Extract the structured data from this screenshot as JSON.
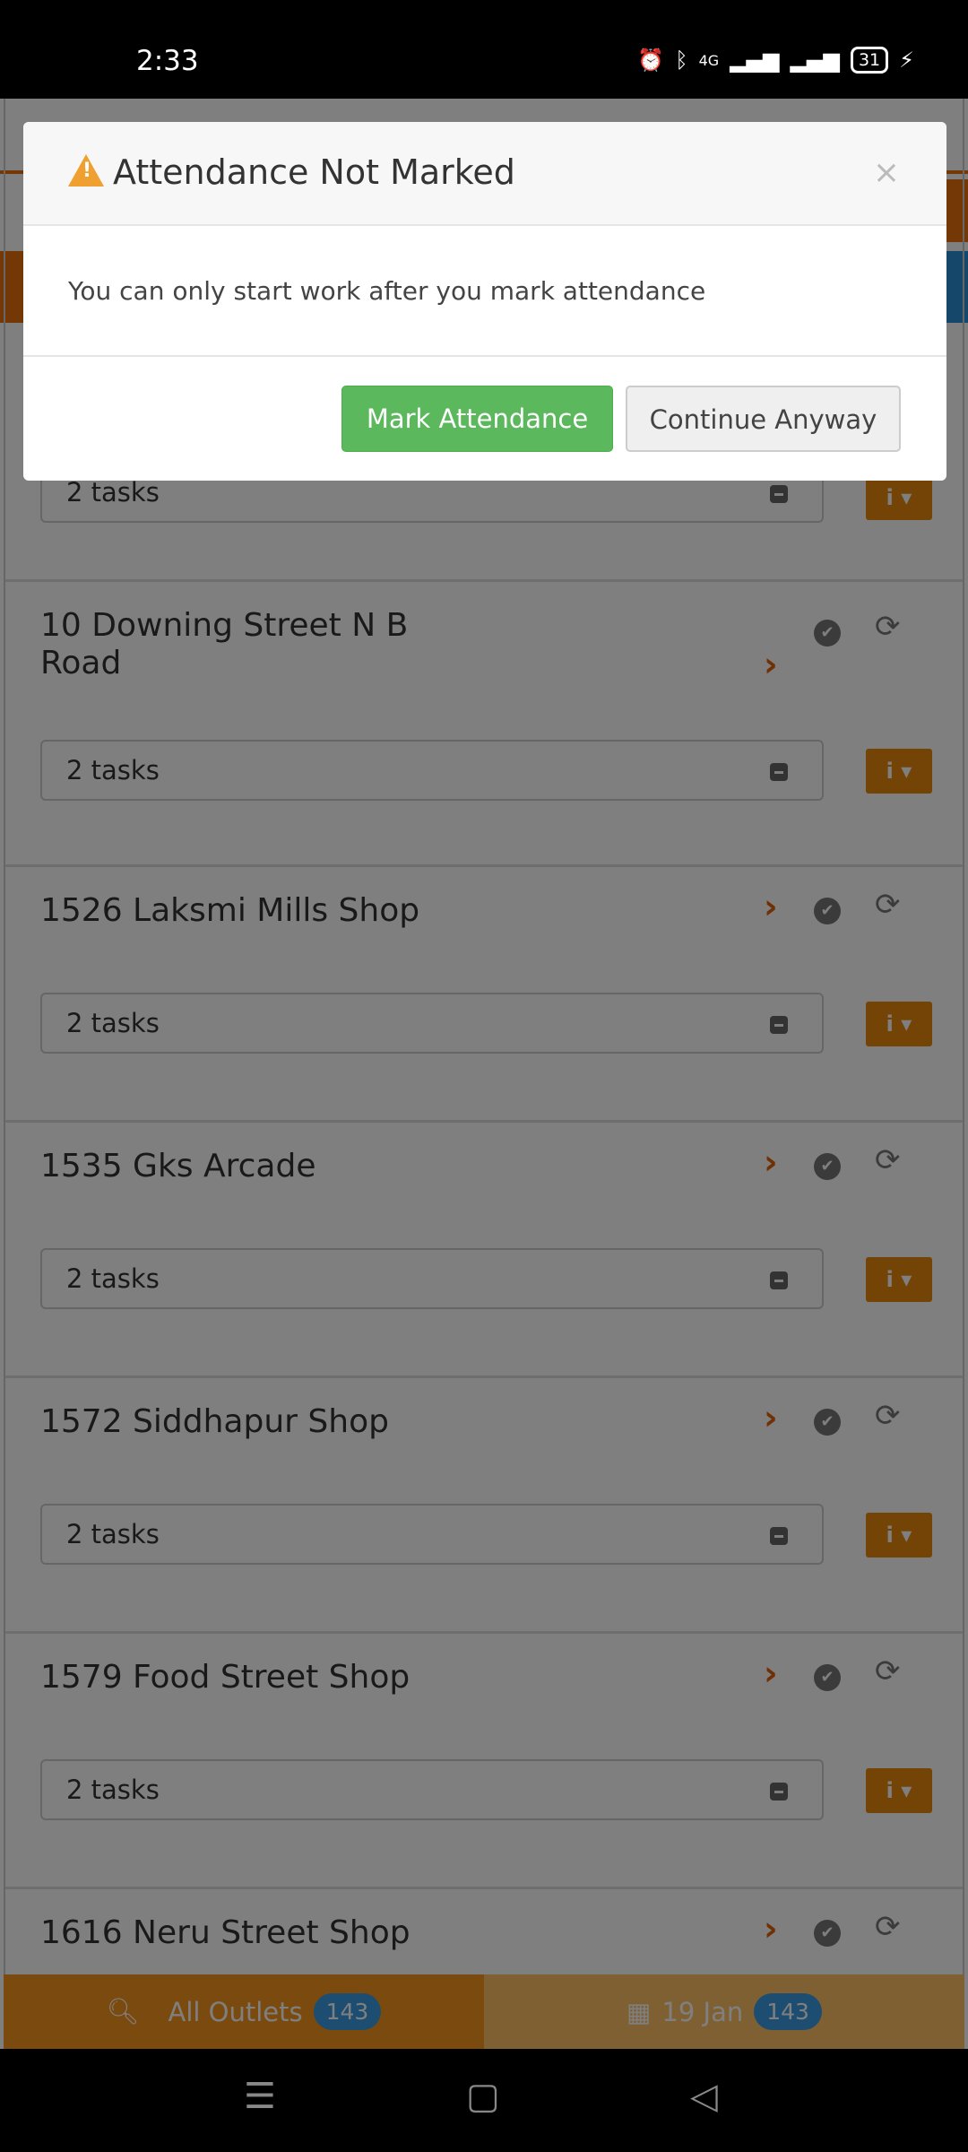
{
  "status_bar": {
    "time": "2:33",
    "battery": "31",
    "network": "4G"
  },
  "modal": {
    "title": "Attendance Not Marked",
    "message": "You can only start work after you mark attendance",
    "close": "×",
    "primary": "Mark Attendance",
    "secondary": "Continue Anyway"
  },
  "outlets": [
    {
      "name": "",
      "tasks": "2 tasks"
    },
    {
      "name": "10 Downing Street N B Road",
      "tasks": "2 tasks"
    },
    {
      "name": "1526 Laksmi Mills Shop",
      "tasks": "2 tasks"
    },
    {
      "name": "1535 Gks Arcade",
      "tasks": "2 tasks"
    },
    {
      "name": "1572 Siddhapur Shop",
      "tasks": "2 tasks"
    },
    {
      "name": "1579 Food Street Shop",
      "tasks": "2 tasks"
    },
    {
      "name": "1616 Neru Street Shop",
      "tasks": ""
    }
  ],
  "bottom_tabs": [
    {
      "label": "All Outlets",
      "count": "143",
      "icon": "search-icon"
    },
    {
      "label": "19 Jan",
      "count": "143",
      "icon": "calendar-icon"
    }
  ],
  "colors": {
    "accent": "#f7951c",
    "primary": "#5cb85c",
    "badge": "#3a9be0"
  }
}
